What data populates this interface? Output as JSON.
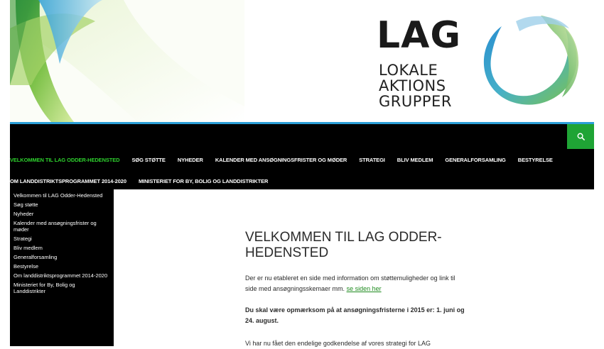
{
  "header": {
    "logo_main": "LAG",
    "logo_lines": [
      "LOKALE",
      "AKTIONS",
      "GRUPPER"
    ]
  },
  "nav": {
    "row1": [
      "VELKOMMEN TIL LAG ODDER-HEDENSTED",
      "SØG STØTTE",
      "NYHEDER",
      "KALENDER MED ANSØGNINGSFRISTER OG MØDER",
      "STRATEGI",
      "BLIV MEDLEM",
      "GENERALFORSAMLING",
      "BESTYRELSE"
    ],
    "row2": [
      "OM LANDDISTRIKTSPROGRAMMET 2014-2020",
      "MINISTERIET FOR BY, BOLIG OG LANDDISTRIKTER"
    ]
  },
  "sidebar": {
    "items": [
      "Velkommen til LAG Odder-Hedensted",
      "Søg støtte",
      "Nyheder",
      "Kalender med ansøgningsfrister og møder",
      "Strategi",
      "Bliv medlem",
      "Generalforsamling",
      "Bestyrelse",
      "Om landdistriktsprogrammet 2014-2020",
      "Ministeriet for By, Bolig og Landdistrikter"
    ]
  },
  "content": {
    "title": "VELKOMMEN TIL LAG ODDER-HEDENSTED",
    "p1_text": "Der er nu etableret en side med information om støttemuligheder og link til side med ansøgningsskemaer mm. ",
    "p1_link": "se siden her",
    "p2": "Du skal være opmærksom på at ansøgningsfristerne i 2015 er: 1. juni og 24. august.",
    "p3": "Vi har nu fået den endelige godkendelse af vores strategi for LAG"
  },
  "colors": {
    "nav_background": "#000000",
    "active_nav": "#2ed12e",
    "accent_line": "#2b9fd7",
    "search_button": "#1fa435",
    "link": "#1d8a1d"
  },
  "icons": {
    "search": "search-icon"
  }
}
